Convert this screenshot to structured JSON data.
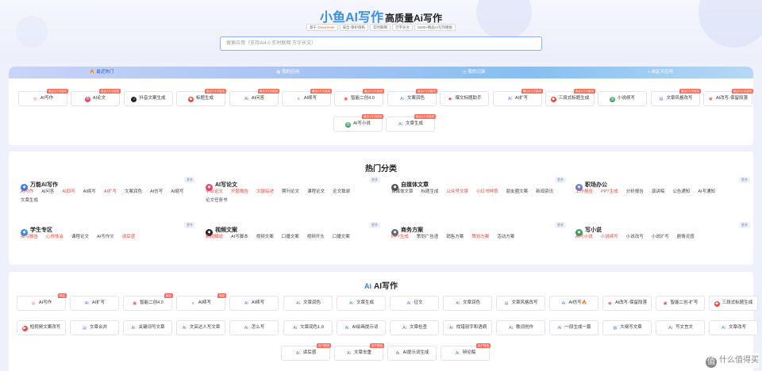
{
  "header": {
    "brand": "小鱼AI写作",
    "subtitle": "高质量Ai写作",
    "tags": [
      {
        "prefix": "基于·",
        "highlight": "DeepSeek"
      },
      {
        "prefix": "安全·保护隐私",
        "highlight": ""
      },
      {
        "prefix": "实时联网",
        "highlight": ""
      },
      {
        "prefix": "万字长文",
        "highlight": ""
      },
      {
        "prefix": "5200+精品AI写作模板",
        "highlight": ""
      }
    ],
    "search_placeholder": "搜索应用（支持Ai4.0 实时联网 万字长文）"
  },
  "tabs": [
    "最近热门",
    "我的应用",
    "我的记录",
    "自定义应用"
  ],
  "recent": [
    {
      "label": "AI写作",
      "badge": "最近3万次使用",
      "icon": "ai-circle-icon"
    },
    {
      "label": "AI论文",
      "badge": "最近3万次使用",
      "icon": "ai-paper-icon"
    },
    {
      "label": "抖音文案生成",
      "badge": "",
      "icon": "tiktok-icon"
    },
    {
      "label": "标题生成",
      "badge": "最近3万次使用",
      "icon": "title-icon"
    },
    {
      "label": "AI问答",
      "badge": "最近3万次使用",
      "icon": "ai-qa-icon"
    },
    {
      "label": "AI续写",
      "badge": "最近3万次使用",
      "icon": "ai-continue-icon"
    },
    {
      "label": "智能二创4.0",
      "badge": "最近2万次使用",
      "icon": "rewrite-icon"
    },
    {
      "label": "文案润色",
      "badge": "最近2万次使用",
      "icon": "polish-icon"
    },
    {
      "label": "爆文标题助手",
      "badge": "",
      "icon": "hot-title-icon"
    },
    {
      "label": "AI扩写",
      "badge": "最近1万次使用",
      "icon": "expand-icon"
    },
    {
      "label": "三段式标题生成",
      "badge": "最近1万次使用",
      "icon": "three-title-icon"
    },
    {
      "label": "小说续写",
      "badge": "",
      "icon": "book-icon"
    },
    {
      "label": "文章风格改写",
      "badge": "最近1万次使用",
      "icon": "style-icon"
    },
    {
      "label": "AI改写-保留段落",
      "badge": "最近1万次使用",
      "icon": "rewrite-keep-icon"
    },
    {
      "label": "AI写小说",
      "badge": "最近1万次使用",
      "icon": "book-icon"
    },
    {
      "label": "文章生成",
      "badge": "最近1万次使用",
      "icon": "article-icon"
    }
  ],
  "hot_title": "热门分类",
  "categories": [
    {
      "name": "万能AI写作",
      "more": "更多",
      "icon_color": "#3a7be8",
      "items": [
        {
          "t": "AI写作",
          "red": true
        },
        {
          "t": "AI问答",
          "red": false
        },
        {
          "t": "AI四写",
          "red": true
        },
        {
          "t": "AI续写",
          "red": false
        },
        {
          "t": "AI扩写",
          "red": true
        },
        {
          "t": "文案润色",
          "red": false
        },
        {
          "t": "AI仿写",
          "red": false
        },
        {
          "t": "AI缩写",
          "red": false
        },
        {
          "t": "文章生成",
          "red": false
        }
      ]
    },
    {
      "name": "AI写论文",
      "more": "更多",
      "icon_color": "#e8457a",
      "items": [
        {
          "t": "毕业论文",
          "red": true
        },
        {
          "t": "开题报告",
          "red": true
        },
        {
          "t": "文献综述",
          "red": true
        },
        {
          "t": "期刊论文",
          "red": false
        },
        {
          "t": "课程论文",
          "red": false
        },
        {
          "t": "论文致谢",
          "red": false
        },
        {
          "t": "论文任务书",
          "red": false
        }
      ]
    },
    {
      "name": "自媒体文章",
      "more": "更多",
      "icon_color": "#555555",
      "items": [
        {
          "t": "自媒体文章",
          "red": false
        },
        {
          "t": "标题生成",
          "red": false
        },
        {
          "t": "公众号文章",
          "red": true
        },
        {
          "t": "小红书种草",
          "red": true
        },
        {
          "t": "朋友圈文案",
          "red": false
        },
        {
          "t": "新闻资讯",
          "red": false
        }
      ]
    },
    {
      "name": "职场办公",
      "more": "更多",
      "icon_color": "#6a7fd0",
      "items": [
        {
          "t": "工作报告",
          "red": true
        },
        {
          "t": "PPT生成",
          "red": true
        },
        {
          "t": "分析报告",
          "red": false
        },
        {
          "t": "演讲稿",
          "red": false
        },
        {
          "t": "公告通知",
          "red": false
        },
        {
          "t": "AI写通知",
          "red": false
        }
      ]
    },
    {
      "name": "学生专区",
      "more": "更多",
      "icon_color": "#3a8fe8",
      "items": [
        {
          "t": "实习报告",
          "red": true
        },
        {
          "t": "心得体会",
          "red": true
        },
        {
          "t": "课程论文",
          "red": false
        },
        {
          "t": "AI写作文",
          "red": false
        },
        {
          "t": "读后感",
          "red": true
        }
      ]
    },
    {
      "name": "视频文案",
      "more": "更多",
      "icon_color": "#222222",
      "items": [
        {
          "t": "影视解说",
          "red": true
        },
        {
          "t": "AI写脚本",
          "red": false
        },
        {
          "t": "视频文案",
          "red": false
        },
        {
          "t": "口播文案",
          "red": false
        },
        {
          "t": "视频开头",
          "red": false
        },
        {
          "t": "口播文案",
          "red": false
        }
      ]
    },
    {
      "name": "商务方案",
      "more": "更多",
      "icon_color": "#5a6a80",
      "items": [
        {
          "t": "PPT生成",
          "red": true
        },
        {
          "t": "策划广告语",
          "red": false
        },
        {
          "t": "销售方案",
          "red": false
        },
        {
          "t": "策划方案",
          "red": true
        },
        {
          "t": "活动方案",
          "red": false
        }
      ]
    },
    {
      "name": "写小说",
      "more": "更多",
      "icon_color": "#3aa060",
      "items": [
        {
          "t": "AI写小说",
          "red": true
        },
        {
          "t": "小说续写",
          "red": true
        },
        {
          "t": "小说改写",
          "red": false
        },
        {
          "t": "小说扩写",
          "red": false
        },
        {
          "t": "剧情灵感",
          "red": false
        }
      ]
    }
  ],
  "section_ai": {
    "title_mark": "Ai",
    "title": "AI写作",
    "cards": [
      {
        "label": "AI写作",
        "badge": "精品",
        "icon": "ai-circle-icon"
      },
      {
        "label": "AI扩写",
        "badge": "",
        "icon": "ai-icon"
      },
      {
        "label": "智能二创4.0",
        "badge": "精品",
        "icon": "rewrite-icon"
      },
      {
        "label": "AI续写",
        "badge": "精品",
        "icon": "ai-continue-icon"
      },
      {
        "label": "AI续写",
        "badge": "",
        "icon": "ai-icon"
      },
      {
        "label": "文章润色",
        "badge": "",
        "icon": "ai-icon"
      },
      {
        "label": "文章生成",
        "badge": "",
        "icon": "ai-icon"
      },
      {
        "label": "征文",
        "badge": "",
        "icon": "ai-icon"
      },
      {
        "label": "文章润色",
        "badge": "",
        "icon": "ai-icon"
      },
      {
        "label": "文章风格改写",
        "badge": "",
        "icon": "style-icon"
      },
      {
        "label": "AI仿写🔥",
        "badge": "",
        "icon": "ai-icon"
      },
      {
        "label": "AI改写-保留段落",
        "badge": "",
        "icon": "rewrite-keep-icon"
      },
      {
        "label": "智能二创-扩写",
        "badge": "",
        "icon": "rewrite-icon"
      },
      {
        "label": "三段式标题生成",
        "badge": "",
        "icon": "three-title-icon"
      },
      {
        "label": "短视频文案改写",
        "badge": "",
        "icon": "video-icon"
      },
      {
        "label": "文章合并",
        "badge": "",
        "icon": "merge-icon"
      },
      {
        "label": "关键词写文章",
        "badge": "",
        "icon": "ai-icon"
      },
      {
        "label": "文采达人写文章",
        "badge": "",
        "icon": "ai-icon"
      },
      {
        "label": "怎么写",
        "badge": "",
        "icon": "ai-icon"
      },
      {
        "label": "文章润色1.0",
        "badge": "",
        "icon": "ai-icon"
      },
      {
        "label": "AI绘画提示词",
        "badge": "",
        "icon": "ai-icon"
      },
      {
        "label": "文章检查",
        "badge": "",
        "icon": "ai-icon"
      },
      {
        "label": "找错别字和语病",
        "badge": "",
        "icon": "ai-icon"
      },
      {
        "label": "歌词创作",
        "badge": "",
        "icon": "ai-icon"
      },
      {
        "label": "一段生成一篇",
        "badge": "",
        "icon": "ai-icon"
      },
      {
        "label": "大纲写文章",
        "badge": "",
        "icon": "outline-icon"
      },
      {
        "label": "写文言文",
        "badge": "",
        "icon": "ai-icon"
      },
      {
        "label": "文章改写",
        "badge": "",
        "icon": "ai-icon"
      },
      {
        "label": "读后感",
        "badge": "用户精选",
        "icon": "ai-icon"
      },
      {
        "label": "文章去重",
        "badge": "用户精选",
        "icon": "ai-icon"
      },
      {
        "label": "AI提示词生成",
        "badge": "",
        "icon": "ai-icon"
      },
      {
        "label": "辩论稿",
        "badge": "用户精选",
        "icon": "ai-icon"
      }
    ]
  },
  "watermark": "什么值得买",
  "colors": {
    "accent": "#3a8fe8",
    "red": "#f0463c",
    "badge": "#ff6a5a"
  }
}
